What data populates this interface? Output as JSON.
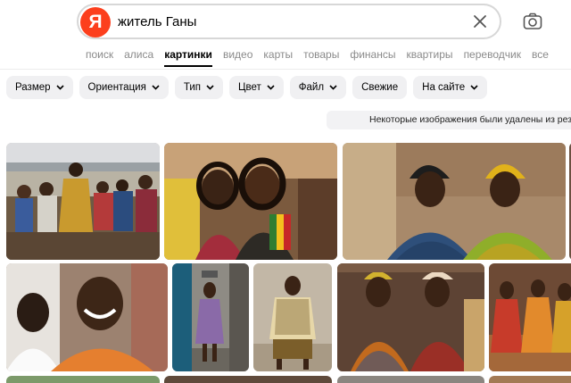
{
  "logo_letter": "Я",
  "search": {
    "query": "житель Ганы"
  },
  "services": [
    "поиск",
    "алиса",
    "картинки",
    "видео",
    "карты",
    "товары",
    "финансы",
    "квартиры",
    "переводчик",
    "все"
  ],
  "filters": [
    "Размер",
    "Ориентация",
    "Тип",
    "Цвет",
    "Файл",
    "Свежие",
    "На сайте"
  ],
  "notice": "Некоторые изображения были удалены из результатов",
  "colors": {
    "brand": "#fc3f1d",
    "chip_bg": "#f0f0f2"
  },
  "icons": [
    "clear-icon",
    "camera-search-icon",
    "chevron-down-icon"
  ]
}
